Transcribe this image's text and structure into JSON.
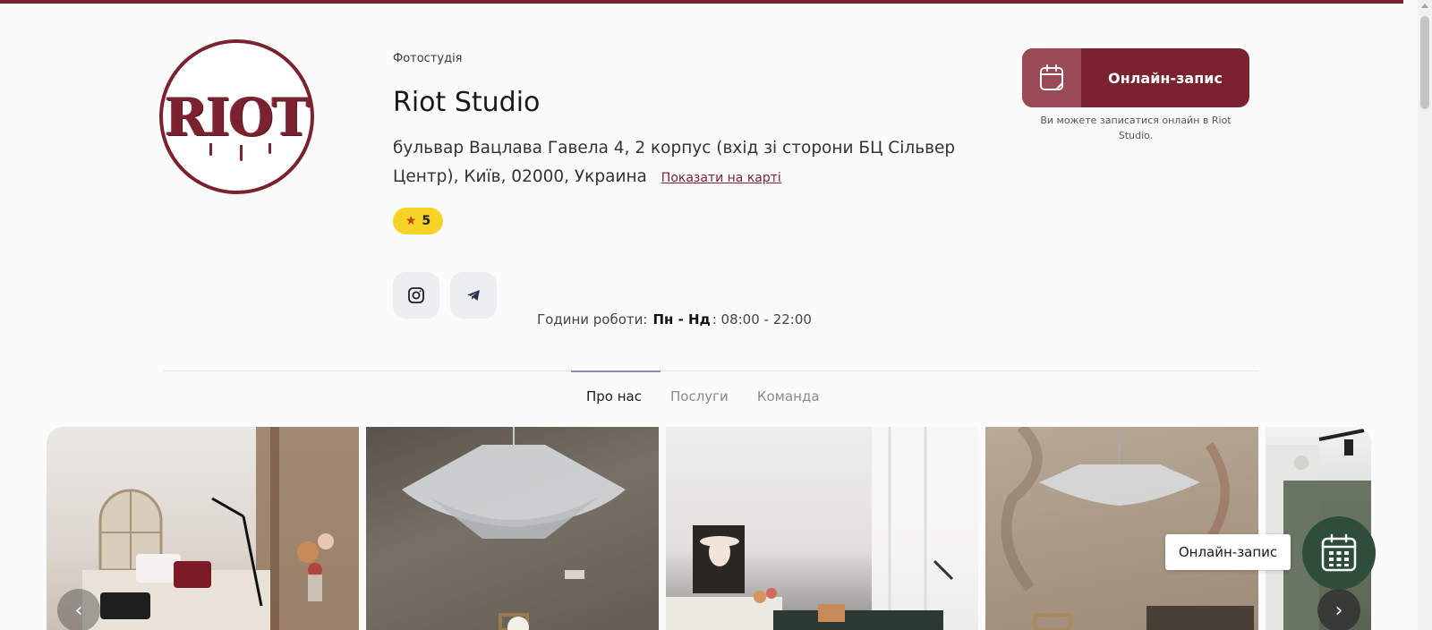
{
  "header": {
    "logo_text": "RIOT",
    "category": "Фотостудія",
    "title": "Riot Studio",
    "address": "бульвар Вацлава Гавела 4, 2 корпус (вхід зі сторони БЦ Сільвер Центр), Київ, 02000, Украина",
    "map_link": "Показати на карті"
  },
  "rating": {
    "value": "5"
  },
  "hours": {
    "label": "Години роботи:",
    "days": "Пн - Нд",
    "time": ": 08:00 - 22:00"
  },
  "booking": {
    "button_label": "Онлайн-запис",
    "note": "Ви можете записатися онлайн в Riot Studio."
  },
  "tabs": [
    {
      "label": "Про нас",
      "active": true
    },
    {
      "label": "Послуги",
      "active": false
    },
    {
      "label": "Команда",
      "active": false
    }
  ],
  "floating": {
    "label": "Онлайн-запис"
  },
  "colors": {
    "brand": "#7a2230",
    "rating": "#f7d327",
    "fab": "#2e4d3b"
  }
}
